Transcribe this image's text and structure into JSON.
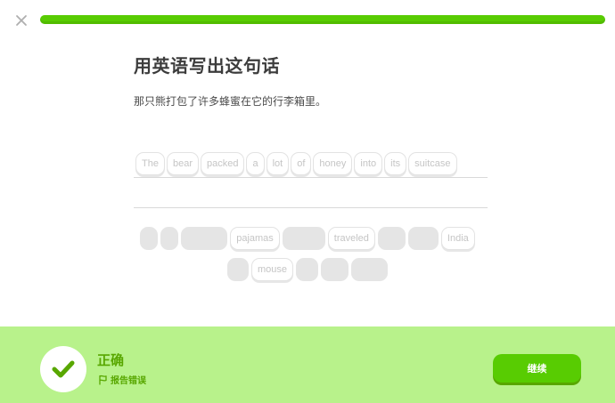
{
  "progress": {
    "fraction": 1.0
  },
  "lesson": {
    "title": "用英语写出这句话",
    "prompt": "那只熊打包了许多蜂蜜在它的行李箱里。"
  },
  "answer": {
    "words": [
      "The",
      "bear",
      "packed",
      "a",
      "lot",
      "of",
      "honey",
      "into",
      "its",
      "suitcase"
    ]
  },
  "word_bank": {
    "row1": [
      {
        "label": "",
        "used": true
      },
      {
        "label": "",
        "used": true
      },
      {
        "label": "",
        "used": true
      },
      {
        "label": "pajamas",
        "used": false
      },
      {
        "label": "",
        "used": true
      },
      {
        "label": "traveled",
        "used": false
      },
      {
        "label": "",
        "used": true
      },
      {
        "label": "",
        "used": true
      },
      {
        "label": "India",
        "used": false
      }
    ],
    "row2": [
      {
        "label": "",
        "used": true
      },
      {
        "label": "mouse",
        "used": false
      },
      {
        "label": "",
        "used": true
      },
      {
        "label": "",
        "used": true
      },
      {
        "label": "",
        "used": true
      }
    ]
  },
  "feedback": {
    "result": "正确",
    "report_label": "报告错误",
    "continue_label": "继续"
  },
  "colors": {
    "accent": "#58cc02",
    "accent_dark": "#58a700",
    "footer_bg": "#b8f28b"
  },
  "icons": {
    "close": "close-icon",
    "check": "check-icon",
    "flag": "flag-icon"
  }
}
